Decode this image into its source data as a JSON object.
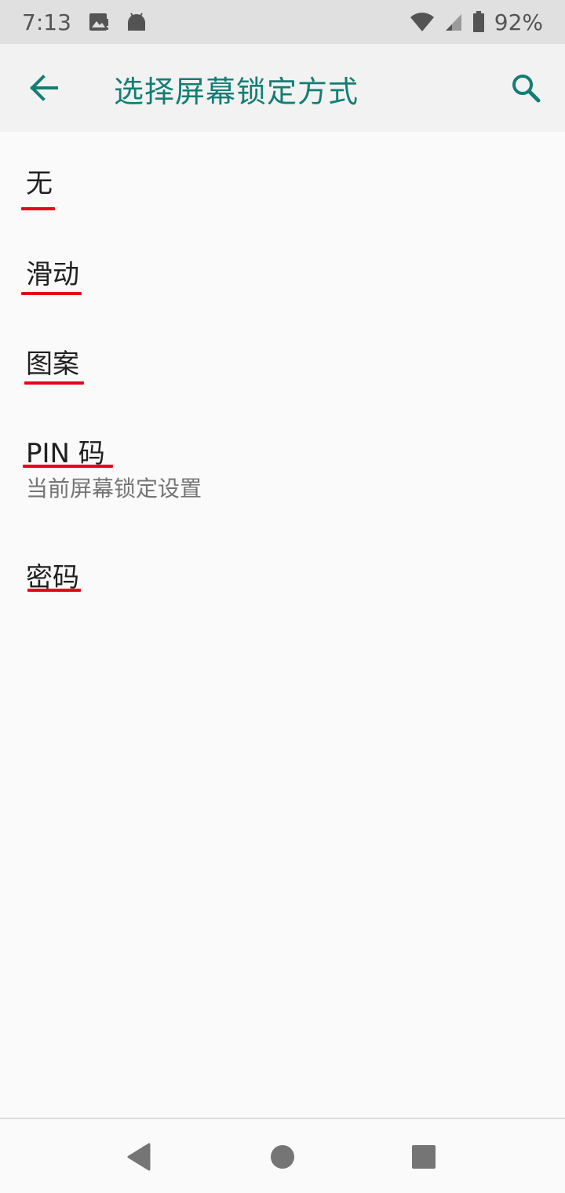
{
  "status_bar": {
    "time": "7:13",
    "battery_text": "92%",
    "icons": [
      "image-notification-icon",
      "android-icon",
      "wifi-icon",
      "signal-icon",
      "battery-icon"
    ]
  },
  "app_bar": {
    "title": "选择屏幕锁定方式",
    "back_icon": "arrow-left-icon",
    "search_icon": "search-icon"
  },
  "options": [
    {
      "title": "无",
      "summary": ""
    },
    {
      "title": "滑动",
      "summary": ""
    },
    {
      "title": "图案",
      "summary": ""
    },
    {
      "title": "PIN 码",
      "summary": "当前屏幕锁定设置"
    },
    {
      "title": "密码",
      "summary": ""
    }
  ],
  "nav_bar": {
    "icons": [
      "back-triangle-icon",
      "home-circle-icon",
      "recents-square-icon"
    ]
  },
  "colors": {
    "accent": "#137e74",
    "underline": "#e8001a",
    "status_bar_bg": "#e0e0e0",
    "app_bar_bg": "#f2f2f2",
    "background": "#fafafa"
  }
}
